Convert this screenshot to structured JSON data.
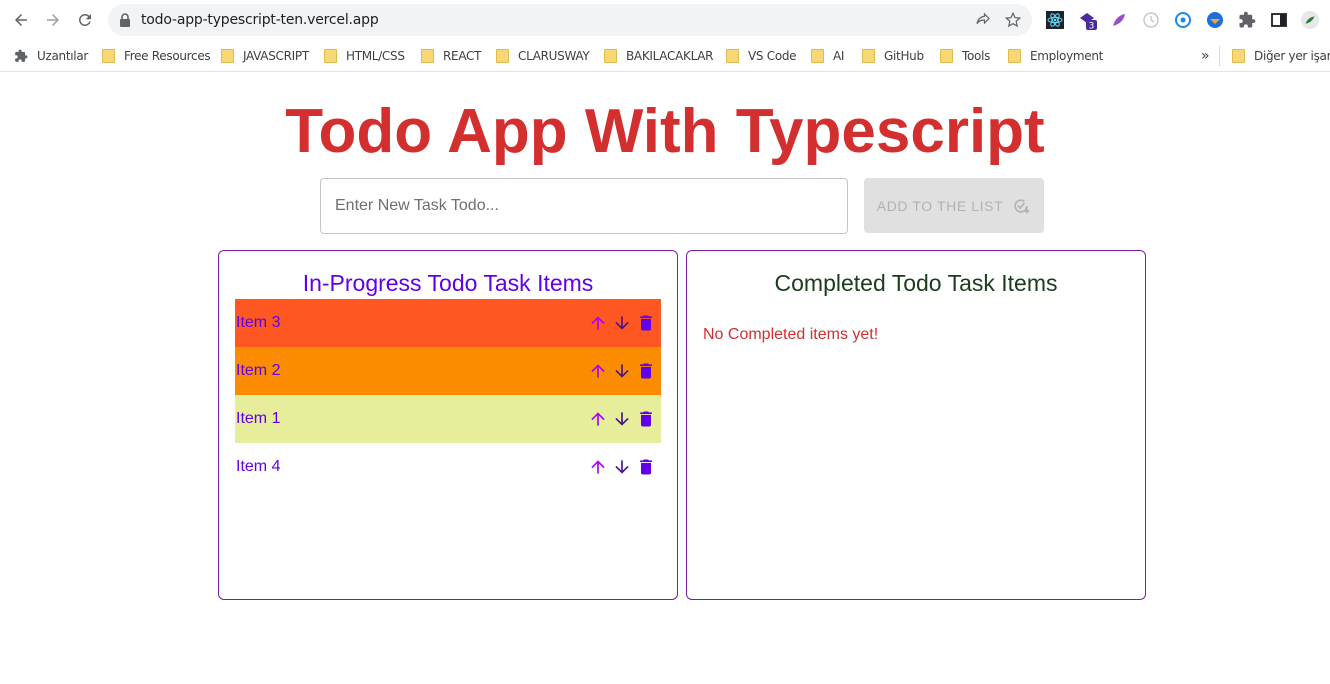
{
  "browser": {
    "url": "todo-app-typescript-ten.vercel.app",
    "bookmarks": [
      {
        "label": "Uzantılar"
      },
      {
        "label": "Free Resources"
      },
      {
        "label": "JAVASCRIPT"
      },
      {
        "label": "HTML/CSS"
      },
      {
        "label": "REACT"
      },
      {
        "label": "CLARUSWAY"
      },
      {
        "label": "BAKILACAKLAR"
      },
      {
        "label": "VS Code"
      },
      {
        "label": "AI"
      },
      {
        "label": "GitHub"
      },
      {
        "label": "Tools"
      },
      {
        "label": "Employment"
      }
    ],
    "more_bookmarks": "»",
    "other_bookmarks": "Diğer yer işare",
    "extension_badge": "3"
  },
  "app": {
    "title": "Todo App With Typescript",
    "input_placeholder": "Enter New Task Todo...",
    "input_value": "",
    "add_button_label": "ADD TO THE LIST"
  },
  "in_progress": {
    "title": "In-Progress Todo Task Items",
    "items": [
      {
        "label": "Item 3",
        "bg": "#ff5722"
      },
      {
        "label": "Item 2",
        "bg": "#fb8c00"
      },
      {
        "label": "Item 1",
        "bg": "#e6ee9c"
      },
      {
        "label": "Item 4",
        "bg": "#ffffff"
      }
    ]
  },
  "completed": {
    "title": "Completed Todo Task Items",
    "empty_message": "No Completed items yet!"
  },
  "colors": {
    "title_red": "#d32f2f",
    "accent_purple": "#6200ea",
    "panel_border": "#7a1fa2",
    "up_arrow": "#aa00ff",
    "down_arrow": "#4a148c",
    "trash": "#6200ea"
  }
}
